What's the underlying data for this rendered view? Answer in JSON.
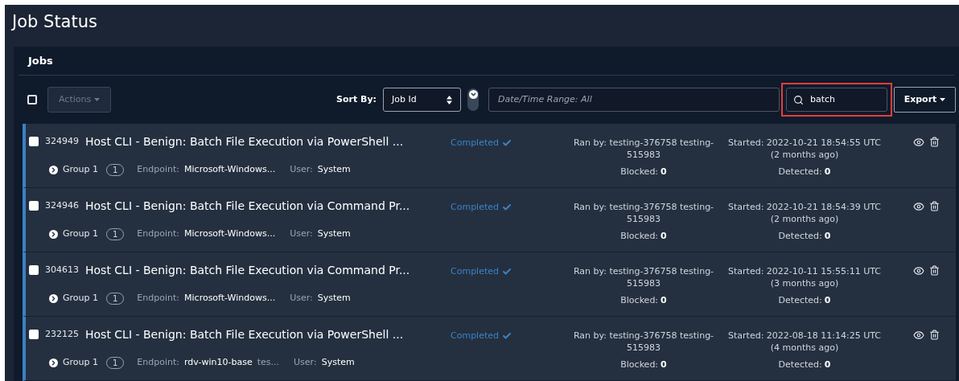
{
  "page": {
    "title": "Job Status"
  },
  "panel": {
    "title": "Jobs"
  },
  "toolbar": {
    "select_all_checked": false,
    "actions_label": "Actions",
    "actions_disabled": true,
    "sort_label": "Sort By:",
    "sort_value": "Job Id",
    "date_placeholder": "Date/Time Range: All",
    "search_value": "batch",
    "search_highlighted": true,
    "export_label": "Export"
  },
  "jobs": [
    {
      "id": "324949",
      "title": "Host CLI - Benign: Batch File Execution via PowerShell ...",
      "checked": false,
      "status": "Completed",
      "ran_by": "Ran by: testing-376758 testing-515983",
      "started": "Started: 2022-10-21 18:54:55 UTC",
      "ago": "(2 months ago)",
      "blocked_label": "Blocked:",
      "blocked": "0",
      "detected_label": "Detected:",
      "detected": "0",
      "group": "Group 1",
      "group_count": "1",
      "endpoint_label": "Endpoint:",
      "endpoint": "Microsoft-Windows...",
      "user_label": "User:",
      "user": "System"
    },
    {
      "id": "324946",
      "title": "Host CLI - Benign: Batch File Execution via Command Pr...",
      "checked": false,
      "status": "Completed",
      "ran_by": "Ran by: testing-376758 testing-515983",
      "started": "Started: 2022-10-21 18:54:39 UTC",
      "ago": "(2 months ago)",
      "blocked_label": "Blocked:",
      "blocked": "0",
      "detected_label": "Detected:",
      "detected": "0",
      "group": "Group 1",
      "group_count": "1",
      "endpoint_label": "Endpoint:",
      "endpoint": "Microsoft-Windows...",
      "user_label": "User:",
      "user": "System"
    },
    {
      "id": "304613",
      "title": "Host CLI - Benign: Batch File Execution via Command Pr...",
      "checked": false,
      "status": "Completed",
      "ran_by": "Ran by: testing-376758 testing-515983",
      "started": "Started: 2022-10-11 15:55:11 UTC",
      "ago": "(3 months ago)",
      "blocked_label": "Blocked:",
      "blocked": "0",
      "detected_label": "Detected:",
      "detected": "0",
      "group": "Group 1",
      "group_count": "1",
      "endpoint_label": "Endpoint:",
      "endpoint": "Microsoft-Windows...",
      "user_label": "User:",
      "user": "System"
    },
    {
      "id": "232125",
      "title": "Host CLI - Benign: Batch File Execution via PowerShell ...",
      "checked": false,
      "status": "Completed",
      "ran_by": "Ran by: testing-376758 testing-515983",
      "started": "Started: 2022-08-18 11:14:25 UTC",
      "ago": "(4 months ago)",
      "blocked_label": "Blocked:",
      "blocked": "0",
      "detected_label": "Detected:",
      "detected": "0",
      "group": "Group 1",
      "group_count": "1",
      "endpoint_label": "Endpoint:",
      "endpoint": "rdv-win10-base",
      "endpoint_extra": "tes...",
      "user_label": "User:",
      "user": "System"
    }
  ]
}
